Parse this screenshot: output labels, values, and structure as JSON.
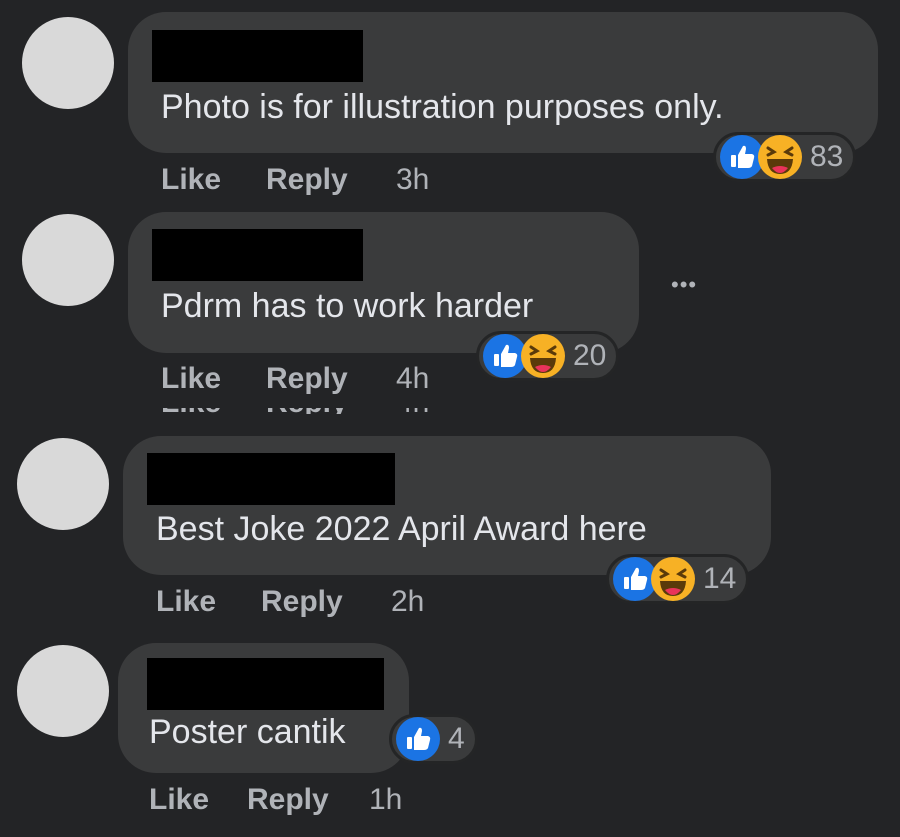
{
  "colors": {
    "background": "#232426",
    "bubble": "#3a3b3c",
    "text": "#e4e6eb",
    "muted": "#b0b3b8",
    "like_blue": "#1b74e4",
    "haha_yellow": "#f7b125"
  },
  "actions": {
    "like_label": "Like",
    "reply_label": "Reply"
  },
  "comments": [
    {
      "text": "Photo is for illustration purposes only.",
      "reaction_icons": [
        "like-icon",
        "haha-icon"
      ],
      "reaction_count": "83",
      "timestamp": "3h"
    },
    {
      "text": "Pdrm has to work harder",
      "reaction_icons": [
        "like-icon",
        "haha-icon"
      ],
      "reaction_count": "20",
      "timestamp": "4h",
      "more_label": "•••"
    },
    {
      "text": "Best Joke 2022 April Award here",
      "reaction_icons": [
        "like-icon",
        "haha-icon"
      ],
      "reaction_count": "14",
      "timestamp": "2h"
    },
    {
      "text": "Poster cantik",
      "reaction_icons": [
        "like-icon"
      ],
      "reaction_count": "4",
      "timestamp": "1h"
    }
  ]
}
